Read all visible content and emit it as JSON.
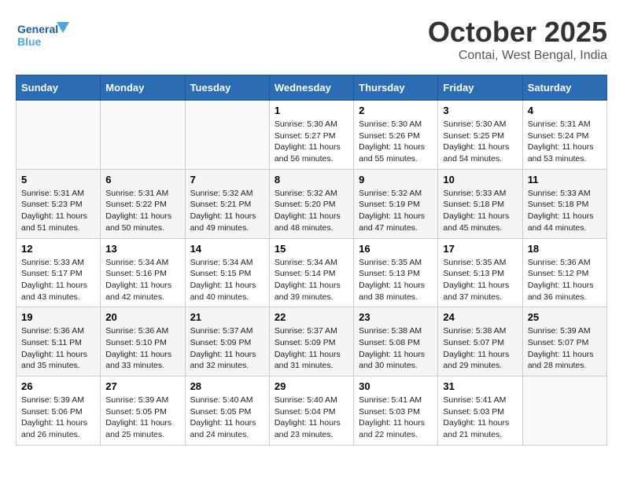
{
  "logo": {
    "line1": "General",
    "line2": "Blue"
  },
  "title": "October 2025",
  "subtitle": "Contai, West Bengal, India",
  "days_of_week": [
    "Sunday",
    "Monday",
    "Tuesday",
    "Wednesday",
    "Thursday",
    "Friday",
    "Saturday"
  ],
  "weeks": [
    [
      {
        "day": "",
        "info": ""
      },
      {
        "day": "",
        "info": ""
      },
      {
        "day": "",
        "info": ""
      },
      {
        "day": "1",
        "info": "Sunrise: 5:30 AM\nSunset: 5:27 PM\nDaylight: 11 hours\nand 56 minutes."
      },
      {
        "day": "2",
        "info": "Sunrise: 5:30 AM\nSunset: 5:26 PM\nDaylight: 11 hours\nand 55 minutes."
      },
      {
        "day": "3",
        "info": "Sunrise: 5:30 AM\nSunset: 5:25 PM\nDaylight: 11 hours\nand 54 minutes."
      },
      {
        "day": "4",
        "info": "Sunrise: 5:31 AM\nSunset: 5:24 PM\nDaylight: 11 hours\nand 53 minutes."
      }
    ],
    [
      {
        "day": "5",
        "info": "Sunrise: 5:31 AM\nSunset: 5:23 PM\nDaylight: 11 hours\nand 51 minutes."
      },
      {
        "day": "6",
        "info": "Sunrise: 5:31 AM\nSunset: 5:22 PM\nDaylight: 11 hours\nand 50 minutes."
      },
      {
        "day": "7",
        "info": "Sunrise: 5:32 AM\nSunset: 5:21 PM\nDaylight: 11 hours\nand 49 minutes."
      },
      {
        "day": "8",
        "info": "Sunrise: 5:32 AM\nSunset: 5:20 PM\nDaylight: 11 hours\nand 48 minutes."
      },
      {
        "day": "9",
        "info": "Sunrise: 5:32 AM\nSunset: 5:19 PM\nDaylight: 11 hours\nand 47 minutes."
      },
      {
        "day": "10",
        "info": "Sunrise: 5:33 AM\nSunset: 5:18 PM\nDaylight: 11 hours\nand 45 minutes."
      },
      {
        "day": "11",
        "info": "Sunrise: 5:33 AM\nSunset: 5:18 PM\nDaylight: 11 hours\nand 44 minutes."
      }
    ],
    [
      {
        "day": "12",
        "info": "Sunrise: 5:33 AM\nSunset: 5:17 PM\nDaylight: 11 hours\nand 43 minutes."
      },
      {
        "day": "13",
        "info": "Sunrise: 5:34 AM\nSunset: 5:16 PM\nDaylight: 11 hours\nand 42 minutes."
      },
      {
        "day": "14",
        "info": "Sunrise: 5:34 AM\nSunset: 5:15 PM\nDaylight: 11 hours\nand 40 minutes."
      },
      {
        "day": "15",
        "info": "Sunrise: 5:34 AM\nSunset: 5:14 PM\nDaylight: 11 hours\nand 39 minutes."
      },
      {
        "day": "16",
        "info": "Sunrise: 5:35 AM\nSunset: 5:13 PM\nDaylight: 11 hours\nand 38 minutes."
      },
      {
        "day": "17",
        "info": "Sunrise: 5:35 AM\nSunset: 5:13 PM\nDaylight: 11 hours\nand 37 minutes."
      },
      {
        "day": "18",
        "info": "Sunrise: 5:36 AM\nSunset: 5:12 PM\nDaylight: 11 hours\nand 36 minutes."
      }
    ],
    [
      {
        "day": "19",
        "info": "Sunrise: 5:36 AM\nSunset: 5:11 PM\nDaylight: 11 hours\nand 35 minutes."
      },
      {
        "day": "20",
        "info": "Sunrise: 5:36 AM\nSunset: 5:10 PM\nDaylight: 11 hours\nand 33 minutes."
      },
      {
        "day": "21",
        "info": "Sunrise: 5:37 AM\nSunset: 5:09 PM\nDaylight: 11 hours\nand 32 minutes."
      },
      {
        "day": "22",
        "info": "Sunrise: 5:37 AM\nSunset: 5:09 PM\nDaylight: 11 hours\nand 31 minutes."
      },
      {
        "day": "23",
        "info": "Sunrise: 5:38 AM\nSunset: 5:08 PM\nDaylight: 11 hours\nand 30 minutes."
      },
      {
        "day": "24",
        "info": "Sunrise: 5:38 AM\nSunset: 5:07 PM\nDaylight: 11 hours\nand 29 minutes."
      },
      {
        "day": "25",
        "info": "Sunrise: 5:39 AM\nSunset: 5:07 PM\nDaylight: 11 hours\nand 28 minutes."
      }
    ],
    [
      {
        "day": "26",
        "info": "Sunrise: 5:39 AM\nSunset: 5:06 PM\nDaylight: 11 hours\nand 26 minutes."
      },
      {
        "day": "27",
        "info": "Sunrise: 5:39 AM\nSunset: 5:05 PM\nDaylight: 11 hours\nand 25 minutes."
      },
      {
        "day": "28",
        "info": "Sunrise: 5:40 AM\nSunset: 5:05 PM\nDaylight: 11 hours\nand 24 minutes."
      },
      {
        "day": "29",
        "info": "Sunrise: 5:40 AM\nSunset: 5:04 PM\nDaylight: 11 hours\nand 23 minutes."
      },
      {
        "day": "30",
        "info": "Sunrise: 5:41 AM\nSunset: 5:03 PM\nDaylight: 11 hours\nand 22 minutes."
      },
      {
        "day": "31",
        "info": "Sunrise: 5:41 AM\nSunset: 5:03 PM\nDaylight: 11 hours\nand 21 minutes."
      },
      {
        "day": "",
        "info": ""
      }
    ]
  ]
}
